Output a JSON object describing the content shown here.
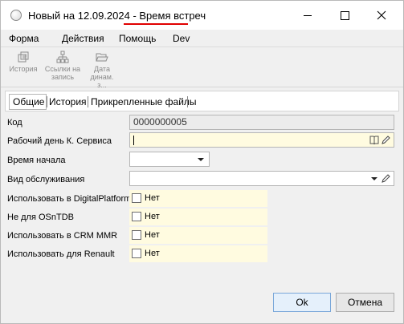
{
  "window": {
    "title_prefix": "Новый на 12.09.2024 - ",
    "title_highlight": "Время встреч"
  },
  "menu": [
    "Форма",
    "Действия",
    "Помощь",
    "Dev"
  ],
  "toolbar": [
    {
      "label": "История",
      "icon": "history-icon"
    },
    {
      "label": "Ссылки на запись",
      "icon": "links-icon"
    },
    {
      "label": "Дата динам. з...",
      "icon": "folder-open-icon"
    }
  ],
  "tabs": [
    "Общие",
    "История",
    "Прикрепленные файлы"
  ],
  "form": {
    "code_label": "Код",
    "code_value": "0000000005",
    "workday_label": "Рабочий день К. Сервиса",
    "workday_value": "",
    "start_time_label": "Время начала",
    "start_time_value": "",
    "service_type_label": "Вид обслуживания",
    "service_type_value": "",
    "checks": [
      {
        "label": "Использовать в DigitalPlatform",
        "value": "Нет",
        "checked": false
      },
      {
        "label": "Не для OSnTDB",
        "value": "Нет",
        "checked": false
      },
      {
        "label": "Использовать в CRM MMR",
        "value": "Нет",
        "checked": false
      },
      {
        "label": "Использовать для Renault",
        "value": "Нет",
        "checked": false
      }
    ]
  },
  "buttons": {
    "ok": "Ok",
    "cancel": "Отмена"
  },
  "colors": {
    "accent_underline": "#e00000",
    "field_highlight": "#fffbe0"
  }
}
